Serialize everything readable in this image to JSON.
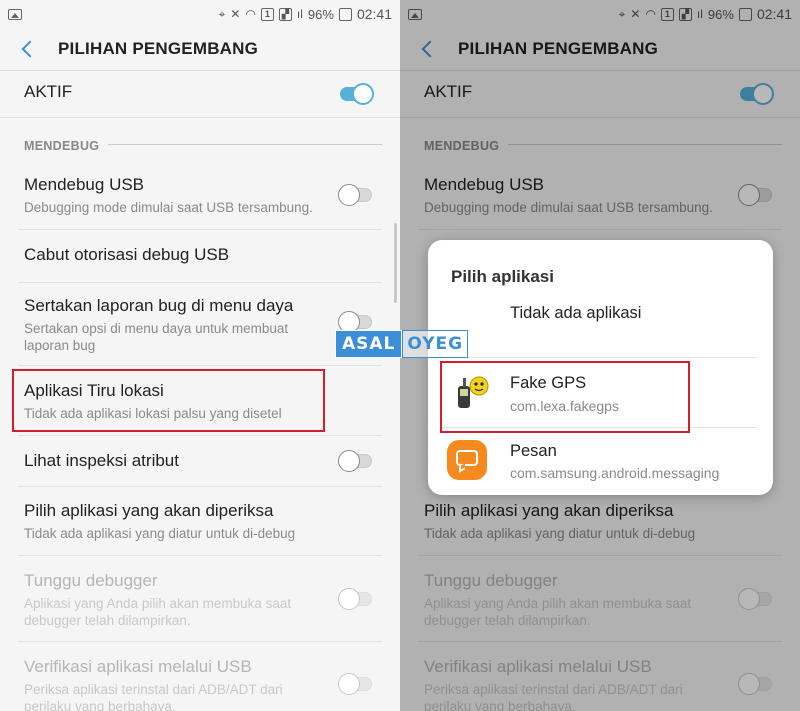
{
  "status_bar": {
    "battery": "96%",
    "time": "02:41"
  },
  "app_bar": {
    "title": "PILIHAN PENGEMBANG"
  },
  "master_toggle": {
    "label": "AKTIF",
    "on": true
  },
  "section": {
    "header": "MENDEBUG"
  },
  "settings": [
    {
      "title": "Mendebug USB",
      "subtitle": "Debugging mode dimulai saat USB tersambung.",
      "toggle": "off"
    },
    {
      "title": "Cabut otorisasi debug USB"
    },
    {
      "title": "Sertakan laporan bug di menu daya",
      "subtitle": "Sertakan opsi di menu daya untuk membuat laporan bug",
      "toggle": "off"
    },
    {
      "title": "Aplikasi Tiru lokasi",
      "subtitle": "Tidak ada aplikasi lokasi palsu yang disetel",
      "highlighted": true
    },
    {
      "title": "Lihat inspeksi atribut",
      "toggle": "off"
    },
    {
      "title": "Pilih aplikasi yang akan diperiksa",
      "subtitle": "Tidak ada aplikasi yang diatur untuk di-debug"
    },
    {
      "title": "Tunggu debugger",
      "subtitle": "Aplikasi yang Anda pilih akan membuka saat debugger telah dilampirkan.",
      "toggle": "disabled"
    },
    {
      "title": "Verifikasi aplikasi melalui USB",
      "subtitle": "Periksa aplikasi terinstal dari ADB/ADT dari perilaku yang berbahaya.",
      "toggle": "disabled"
    }
  ],
  "dialog": {
    "title": "Pilih aplikasi",
    "items": [
      {
        "name": "Tidak ada aplikasi",
        "package": ""
      },
      {
        "name": "Fake GPS",
        "package": "com.lexa.fakegps",
        "icon": "fake-gps-icon",
        "highlighted": true
      },
      {
        "name": "Pesan",
        "package": "com.samsung.android.messaging",
        "icon": "messages-icon"
      }
    ]
  },
  "watermark": {
    "part1": "ASAL",
    "part2": "OYEG"
  },
  "colors": {
    "accent": "#57b0d8",
    "highlight": "#d11f2b",
    "messages_orange": "#f58a1f"
  }
}
